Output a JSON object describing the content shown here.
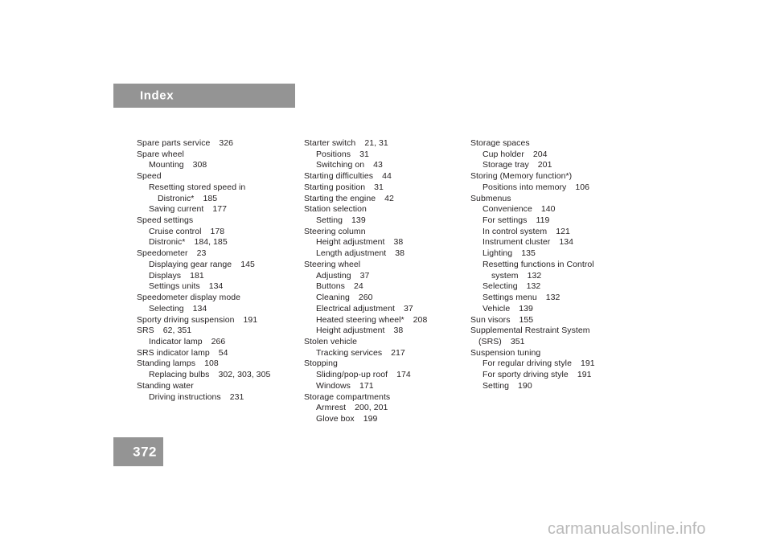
{
  "header": {
    "title": "Index"
  },
  "page_number": "372",
  "watermark": "carmanualsonline.info",
  "colors": {
    "bar_gray": "#949494",
    "text": "#231f20",
    "watermark_gray": "#b9b9b9",
    "page_background": "#ffffff"
  },
  "columns": [
    {
      "id": "column-1",
      "entries": [
        {
          "level": 0,
          "label": "Spare parts service",
          "pages": "326"
        },
        {
          "level": 0,
          "label": "Spare wheel",
          "pages": ""
        },
        {
          "level": 1,
          "label": "Mounting",
          "pages": "308"
        },
        {
          "level": 0,
          "label": "Speed",
          "pages": ""
        },
        {
          "level": 1,
          "label": "Resetting stored speed in",
          "pages": ""
        },
        {
          "level": 2,
          "label": "Distronic*",
          "pages": "185"
        },
        {
          "level": 1,
          "label": "Saving current",
          "pages": "177"
        },
        {
          "level": 0,
          "label": "Speed settings",
          "pages": ""
        },
        {
          "level": 1,
          "label": "Cruise control",
          "pages": "178"
        },
        {
          "level": 1,
          "label": "Distronic*",
          "pages": "184, 185"
        },
        {
          "level": 0,
          "label": "Speedometer",
          "pages": "23"
        },
        {
          "level": 1,
          "label": "Displaying gear range",
          "pages": "145"
        },
        {
          "level": 1,
          "label": "Displays",
          "pages": "181"
        },
        {
          "level": 1,
          "label": "Settings units",
          "pages": "134"
        },
        {
          "level": 0,
          "label": "Speedometer display mode",
          "pages": ""
        },
        {
          "level": 1,
          "label": "Selecting",
          "pages": "134"
        },
        {
          "level": 0,
          "label": "Sporty driving suspension",
          "pages": "191"
        },
        {
          "level": 0,
          "label": "SRS",
          "pages": "62, 351"
        },
        {
          "level": 1,
          "label": "Indicator lamp",
          "pages": "266"
        },
        {
          "level": 0,
          "label": "SRS indicator lamp",
          "pages": "54"
        },
        {
          "level": 0,
          "label": "Standing lamps",
          "pages": "108"
        },
        {
          "level": 1,
          "label": "Replacing bulbs",
          "pages": "302, 303, 305"
        },
        {
          "level": 0,
          "label": "Standing water",
          "pages": ""
        },
        {
          "level": 1,
          "label": "Driving instructions",
          "pages": "231"
        }
      ]
    },
    {
      "id": "column-2",
      "entries": [
        {
          "level": 0,
          "label": "Starter switch",
          "pages": "21, 31"
        },
        {
          "level": 1,
          "label": "Positions",
          "pages": "31"
        },
        {
          "level": 1,
          "label": "Switching on",
          "pages": "43"
        },
        {
          "level": 0,
          "label": "Starting difficulties",
          "pages": "44"
        },
        {
          "level": 0,
          "label": "Starting position",
          "pages": "31"
        },
        {
          "level": 0,
          "label": "Starting the engine",
          "pages": "42"
        },
        {
          "level": 0,
          "label": "Station selection",
          "pages": ""
        },
        {
          "level": 1,
          "label": "Setting",
          "pages": "139"
        },
        {
          "level": 0,
          "label": "Steering column",
          "pages": ""
        },
        {
          "level": 1,
          "label": "Height adjustment",
          "pages": "38"
        },
        {
          "level": 1,
          "label": "Length adjustment",
          "pages": "38"
        },
        {
          "level": 0,
          "label": "Steering wheel",
          "pages": ""
        },
        {
          "level": 1,
          "label": "Adjusting",
          "pages": "37"
        },
        {
          "level": 1,
          "label": "Buttons",
          "pages": "24"
        },
        {
          "level": 1,
          "label": "Cleaning",
          "pages": "260"
        },
        {
          "level": 1,
          "label": "Electrical adjustment",
          "pages": "37"
        },
        {
          "level": 1,
          "label": "Heated steering wheel*",
          "pages": "208"
        },
        {
          "level": 1,
          "label": "Height adjustment",
          "pages": "38"
        },
        {
          "level": 0,
          "label": "Stolen vehicle",
          "pages": ""
        },
        {
          "level": 1,
          "label": "Tracking services",
          "pages": "217"
        },
        {
          "level": 0,
          "label": "Stopping",
          "pages": ""
        },
        {
          "level": 1,
          "label": "Sliding/pop-up roof",
          "pages": "174"
        },
        {
          "level": 1,
          "label": "Windows",
          "pages": "171"
        },
        {
          "level": 0,
          "label": "Storage compartments",
          "pages": ""
        },
        {
          "level": 1,
          "label": "Armrest",
          "pages": "200, 201"
        },
        {
          "level": 1,
          "label": "Glove box",
          "pages": "199"
        }
      ]
    },
    {
      "id": "column-3",
      "entries": [
        {
          "level": 0,
          "label": "Storage spaces",
          "pages": ""
        },
        {
          "level": 1,
          "label": "Cup holder",
          "pages": "204"
        },
        {
          "level": 1,
          "label": "Storage tray",
          "pages": "201"
        },
        {
          "level": 0,
          "label": "Storing (Memory function*)",
          "pages": ""
        },
        {
          "level": 1,
          "label": "Positions into memory",
          "pages": "106"
        },
        {
          "level": 0,
          "label": "Submenus",
          "pages": ""
        },
        {
          "level": 1,
          "label": "Convenience",
          "pages": "140"
        },
        {
          "level": 1,
          "label": "For settings",
          "pages": "119"
        },
        {
          "level": 1,
          "label": "In control system",
          "pages": "121"
        },
        {
          "level": 1,
          "label": "Instrument cluster",
          "pages": "134"
        },
        {
          "level": 1,
          "label": "Lighting",
          "pages": "135"
        },
        {
          "level": 1,
          "label": "Resetting functions in Control",
          "pages": ""
        },
        {
          "level": 2,
          "label": "system",
          "pages": "132"
        },
        {
          "level": 1,
          "label": "Selecting",
          "pages": "132"
        },
        {
          "level": 1,
          "label": "Settings menu",
          "pages": "132"
        },
        {
          "level": 1,
          "label": "Vehicle",
          "pages": "139"
        },
        {
          "level": 0,
          "label": "Sun visors",
          "pages": "155"
        },
        {
          "level": 0,
          "label": "Supplemental Restraint System",
          "pages": ""
        },
        {
          "level": 9,
          "label": "(SRS)",
          "pages": "351"
        },
        {
          "level": 0,
          "label": "Suspension tuning",
          "pages": ""
        },
        {
          "level": 1,
          "label": "For regular driving style",
          "pages": "191"
        },
        {
          "level": 1,
          "label": "For sporty driving style",
          "pages": "191"
        },
        {
          "level": 1,
          "label": "Setting",
          "pages": "190"
        }
      ]
    }
  ]
}
